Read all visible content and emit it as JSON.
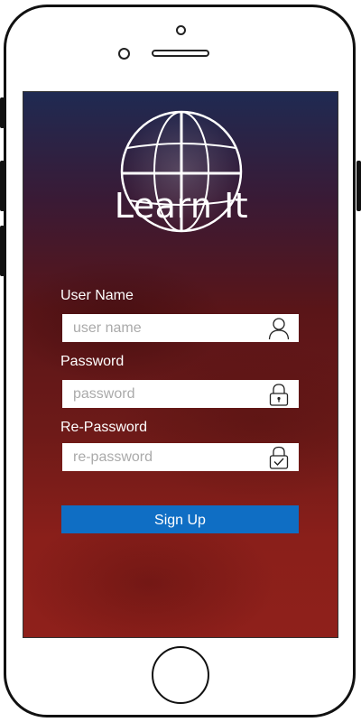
{
  "app": {
    "title": "Learn It"
  },
  "form": {
    "username": {
      "label": "User Name",
      "placeholder": "user name",
      "value": ""
    },
    "password": {
      "label": "Password",
      "placeholder": "password",
      "value": ""
    },
    "repassword": {
      "label": "Re-Password",
      "placeholder": "re-password",
      "value": ""
    },
    "signup_label": "Sign Up"
  },
  "icons": {
    "logo": "globe-icon",
    "username": "user-icon",
    "password": "lock-icon",
    "repassword": "lock-check-icon"
  },
  "colors": {
    "button": "#0f6ec4",
    "background_top": "#1f2a52",
    "background_bottom": "#8f201b"
  }
}
